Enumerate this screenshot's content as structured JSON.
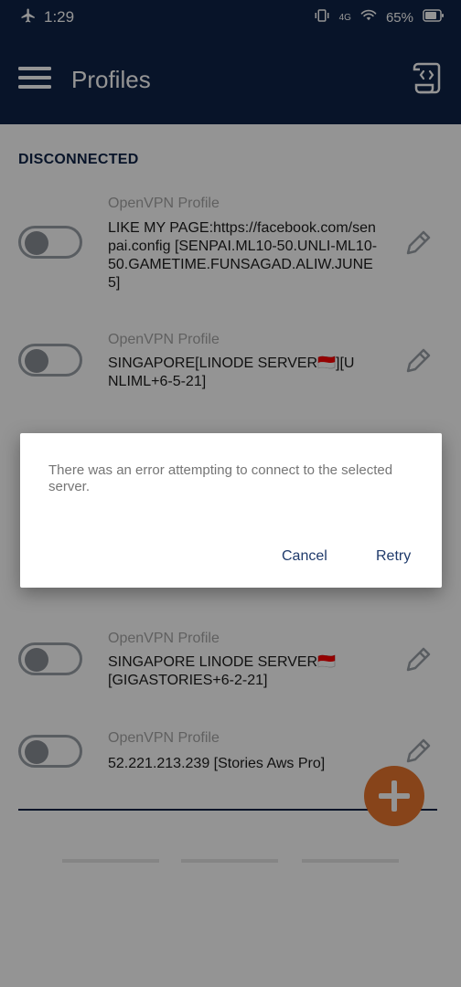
{
  "status_bar": {
    "time": "1:29",
    "network": "4G",
    "battery": "65%"
  },
  "app_bar": {
    "title": "Profiles"
  },
  "section": {
    "title": "DISCONNECTED"
  },
  "profiles": [
    {
      "type": "OpenVPN Profile",
      "name": "LIKE MY PAGE:https://facebook.com/senpai.config [SENPAI.ML10-50.UNLI-ML10-50.GAMETIME.FUNSAGAD.ALIW.JUNE5]",
      "enabled": false
    },
    {
      "type": "OpenVPN Profile",
      "name": "SINGAPORE[LINODE SERVER🇮🇩][UNLIML+6-5-21]",
      "enabled": false
    },
    {
      "type": "OpenVPN Profile",
      "name": "SINGAPORE LINODE SERVER🇮🇩 [GIGASTORIES+6-2-21]",
      "enabled": false
    },
    {
      "type": "OpenVPN Profile",
      "name": "52.221.213.239 [Stories Aws Pro]",
      "enabled": false
    }
  ],
  "dialog": {
    "message": "There was an error attempting to connect to the selected server.",
    "cancel_label": "Cancel",
    "retry_label": "Retry"
  },
  "colors": {
    "primary": "#0f2447",
    "accent": "#e8762d"
  }
}
